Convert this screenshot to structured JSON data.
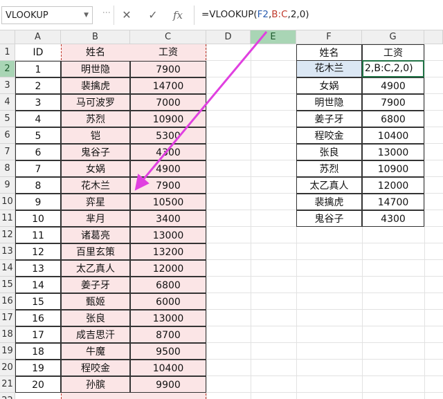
{
  "formula_bar": {
    "name_box": "VLOOKUP",
    "cancel_icon": "✕",
    "enter_icon": "✓",
    "fx_label": "fx",
    "formula_prefix": "=VLOOKUP(",
    "formula_arg1": "F2",
    "formula_sep1": ",",
    "formula_arg2": "B:C",
    "formula_suffix": ",2,0)"
  },
  "columns": [
    "A",
    "B",
    "C",
    "D",
    "E",
    "F",
    "G"
  ],
  "rows": [
    "1",
    "2",
    "3",
    "4",
    "5",
    "6",
    "7",
    "8",
    "9",
    "10",
    "11",
    "12",
    "13",
    "14",
    "15",
    "16",
    "17",
    "18",
    "19",
    "20",
    "21",
    "22"
  ],
  "left_table": {
    "headers": [
      "ID",
      "姓名",
      "工资"
    ],
    "rows": [
      [
        "1",
        "明世隐",
        "7900"
      ],
      [
        "2",
        "裴擒虎",
        "14700"
      ],
      [
        "3",
        "马可波罗",
        "7000"
      ],
      [
        "4",
        "苏烈",
        "10900"
      ],
      [
        "5",
        "铠",
        "5300"
      ],
      [
        "6",
        "鬼谷子",
        "4300"
      ],
      [
        "7",
        "女娲",
        "4900"
      ],
      [
        "8",
        "花木兰",
        "7900"
      ],
      [
        "9",
        "弈星",
        "10500"
      ],
      [
        "10",
        "芈月",
        "3400"
      ],
      [
        "11",
        "诸葛亮",
        "13000"
      ],
      [
        "12",
        "百里玄策",
        "13200"
      ],
      [
        "13",
        "太乙真人",
        "12000"
      ],
      [
        "14",
        "姜子牙",
        "6800"
      ],
      [
        "15",
        "甄姬",
        "6000"
      ],
      [
        "16",
        "张良",
        "13000"
      ],
      [
        "17",
        "成吉思汗",
        "8700"
      ],
      [
        "18",
        "牛魔",
        "9500"
      ],
      [
        "19",
        "程咬金",
        "10400"
      ],
      [
        "20",
        "孙膑",
        "9900"
      ]
    ]
  },
  "right_table": {
    "headers": [
      "姓名",
      "工资"
    ],
    "editing_value": "2,B:C,2,0)",
    "rows": [
      [
        "花木兰",
        ""
      ],
      [
        "女娲",
        "4900"
      ],
      [
        "明世隐",
        "7900"
      ],
      [
        "姜子牙",
        "6800"
      ],
      [
        "程咬金",
        "10400"
      ],
      [
        "张良",
        "13000"
      ],
      [
        "苏烈",
        "10900"
      ],
      [
        "太乙真人",
        "12000"
      ],
      [
        "裴擒虎",
        "14700"
      ],
      [
        "鬼谷子",
        "4300"
      ]
    ]
  },
  "colors": {
    "range_highlight": "#fbe5e6",
    "range_border": "#c0392b",
    "arrow": "#e040e0",
    "active_header": "#a9d5b5",
    "edit_border": "#217346",
    "formula_ref_blue": "#2a5db0",
    "formula_ref_red": "#c0392b"
  }
}
